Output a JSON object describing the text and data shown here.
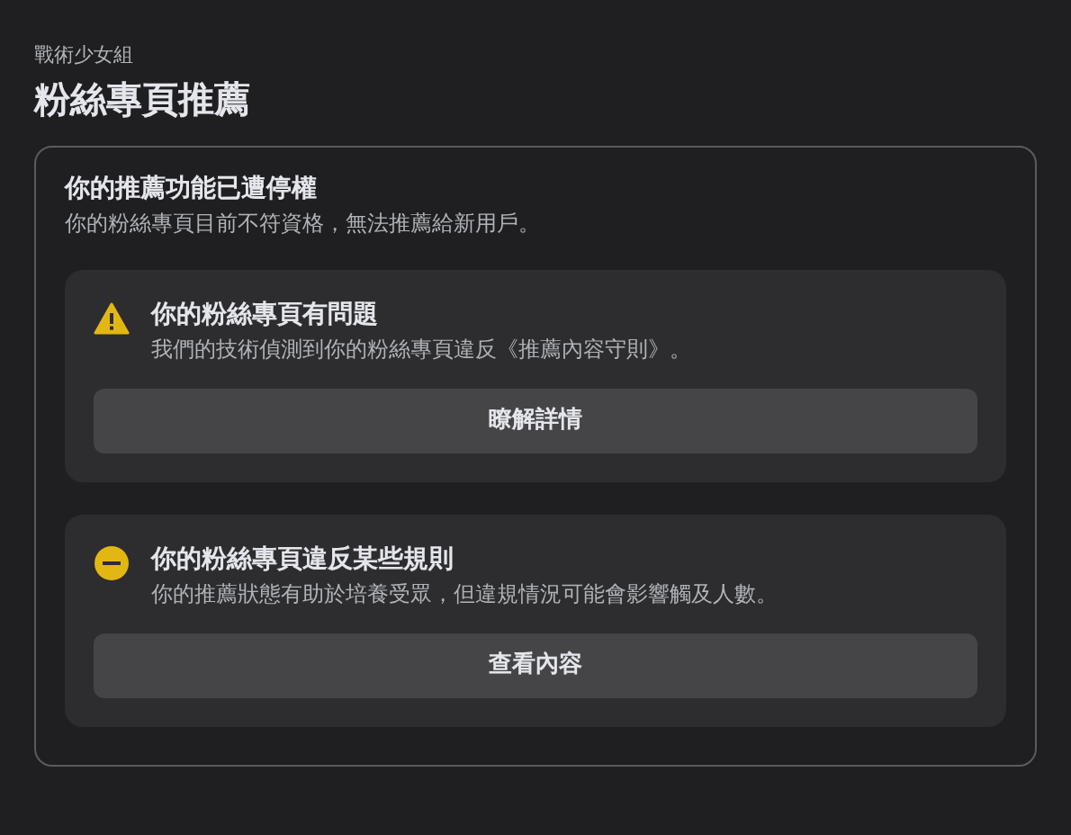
{
  "page": {
    "subtitle": "戰術少女組",
    "title": "粉絲專頁推薦"
  },
  "status": {
    "heading": "你的推薦功能已遭停權",
    "description": "你的粉絲專頁目前不符資格，無法推薦給新用戶。",
    "issues": [
      {
        "kind": "warning",
        "title": "你的粉絲專頁有問題",
        "description": "我們的技術偵測到你的粉絲專頁違反《推薦內容守則》。",
        "button": "瞭解詳情"
      },
      {
        "kind": "restricted",
        "title": "你的粉絲專頁違反某些規則",
        "description": "你的推薦狀態有助於培養受眾，但違規情況可能會影響觸及人數。",
        "button": "查看內容"
      }
    ]
  }
}
